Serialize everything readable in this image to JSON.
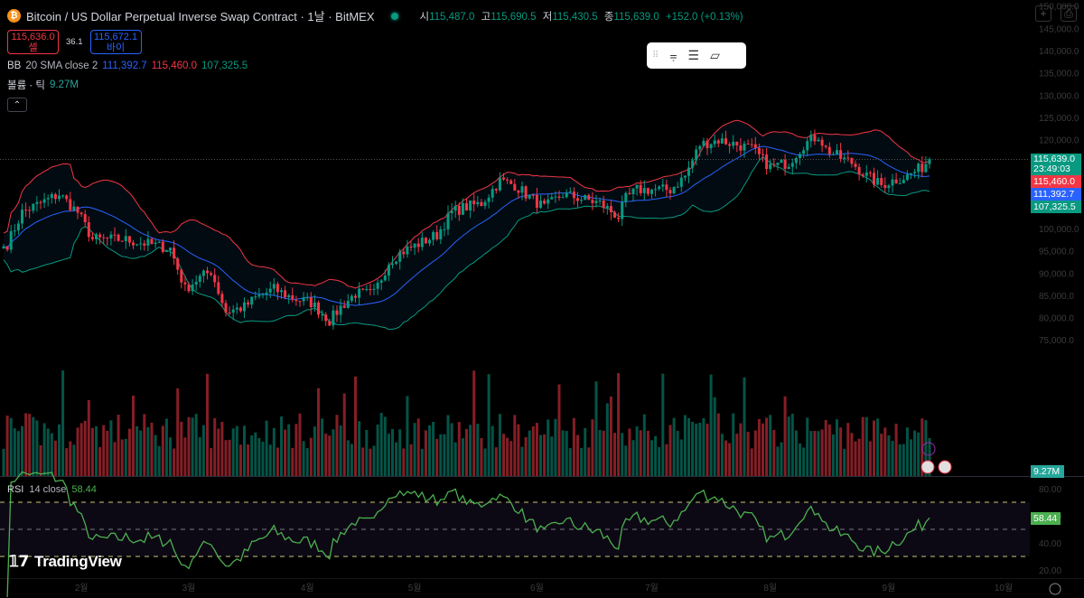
{
  "header": {
    "symbol_logo": "₿",
    "title": "Bitcoin / US Dollar Perpetual Inverse Swap Contract · 1날 · BitMEX",
    "ohlc": {
      "o_label": "시",
      "o": "115,487.0",
      "h_label": "고",
      "h": "115,690.5",
      "l_label": "저",
      "l": "115,430.5",
      "c_label": "종",
      "c": "115,639.0",
      "change": "+152.0 (+0.13%)"
    }
  },
  "trade": {
    "sell_price": "115,636.0",
    "sell_label": "셀",
    "spread": "36.1",
    "buy_price": "115,672.1",
    "buy_label": "바이"
  },
  "indicators": {
    "bb": {
      "label": "BB",
      "params": "20 SMA close 2",
      "basis": "111,392.7",
      "upper": "115,460.0",
      "lower": "107,325.5"
    },
    "volume": {
      "label": "볼륨 · 틱",
      "value": "9.27M"
    },
    "rsi": {
      "label": "RSI",
      "params": "14 close",
      "value": "58.44"
    }
  },
  "price_labels": {
    "last": "115,639.0",
    "countdown": "23:49:03",
    "upper": "115,460.0",
    "basis": "111,392.7",
    "lower": "107,325.5",
    "volume": "9.27M",
    "rsi": "58.44"
  },
  "collapse_icon": "chevron-up-icon",
  "toolbar_icons": [
    "drag-handle-icon",
    "trend-line-icon",
    "parallel-channel-icon",
    "rectangle-icon"
  ],
  "branding": "TradingView",
  "colors": {
    "up": "#089981",
    "down": "#f23645",
    "basis": "#2962ff",
    "rsi": "#4caf50"
  },
  "chart_data": {
    "type": "candlestick",
    "title": "Bitcoin / US Dollar Perpetual Inverse Swap Contract · 1D · BitMEX",
    "close_keypoints": [
      [
        0,
        96000
      ],
      [
        1,
        96557
      ],
      [
        5,
        103662
      ],
      [
        10,
        105692
      ],
      [
        15,
        107722
      ],
      [
        20,
        103662
      ],
      [
        24,
        97572
      ],
      [
        32,
        97572
      ],
      [
        39,
        96557
      ],
      [
        45,
        95542
      ],
      [
        49,
        86407
      ],
      [
        52,
        88437
      ],
      [
        56,
        90467
      ],
      [
        60,
        81332
      ],
      [
        65,
        82347
      ],
      [
        68,
        84377
      ],
      [
        73,
        86407
      ],
      [
        78,
        84377
      ],
      [
        83,
        83362
      ],
      [
        88,
        79302
      ],
      [
        91,
        82347
      ],
      [
        95,
        85392
      ],
      [
        100,
        85392
      ],
      [
        104,
        92497
      ],
      [
        107,
        94527
      ],
      [
        112,
        96557
      ],
      [
        117,
        98587
      ],
      [
        121,
        103662
      ],
      [
        124,
        104677
      ],
      [
        129,
        105692
      ],
      [
        134,
        110767
      ],
      [
        138,
        109752
      ],
      [
        141,
        107722
      ],
      [
        146,
        104677
      ],
      [
        151,
        107722
      ],
      [
        156,
        106707
      ],
      [
        161,
        105692
      ],
      [
        166,
        102647
      ],
      [
        168,
        106707
      ],
      [
        171,
        108737
      ],
      [
        176,
        108737
      ],
      [
        180,
        108737
      ],
      [
        184,
        111782
      ],
      [
        188,
        118887
      ],
      [
        193,
        119902
      ],
      [
        198,
        118887
      ],
      [
        202,
        117872
      ],
      [
        207,
        113812
      ],
      [
        212,
        114827
      ],
      [
        216,
        118887
      ],
      [
        220,
        120917
      ],
      [
        222,
        117872
      ],
      [
        226,
        115842
      ],
      [
        229,
        114827
      ],
      [
        233,
        111782
      ],
      [
        237,
        109752
      ],
      [
        240,
        110767
      ],
      [
        244,
        111782
      ],
      [
        248,
        113812
      ],
      [
        250,
        115639
      ]
    ],
    "price_ticks": [
      150000,
      145000,
      140000,
      135000,
      130000,
      125000,
      120000,
      115000,
      110000,
      105000,
      100000,
      95000,
      90000,
      85000,
      80000,
      75000
    ],
    "rsi_ticks": [
      80,
      60,
      40,
      20
    ],
    "rsi_bands": [
      70,
      50,
      30
    ],
    "time_ticks": [
      {
        "day": 21,
        "label": "2월"
      },
      {
        "day": 50,
        "label": "3월"
      },
      {
        "day": 82,
        "label": "4월"
      },
      {
        "day": 111,
        "label": "5월"
      },
      {
        "day": 144,
        "label": "6월"
      },
      {
        "day": 175,
        "label": "7월"
      },
      {
        "day": 207,
        "label": "8월"
      },
      {
        "day": 239,
        "label": "9월"
      },
      {
        "day": 270,
        "label": "10월"
      }
    ]
  }
}
